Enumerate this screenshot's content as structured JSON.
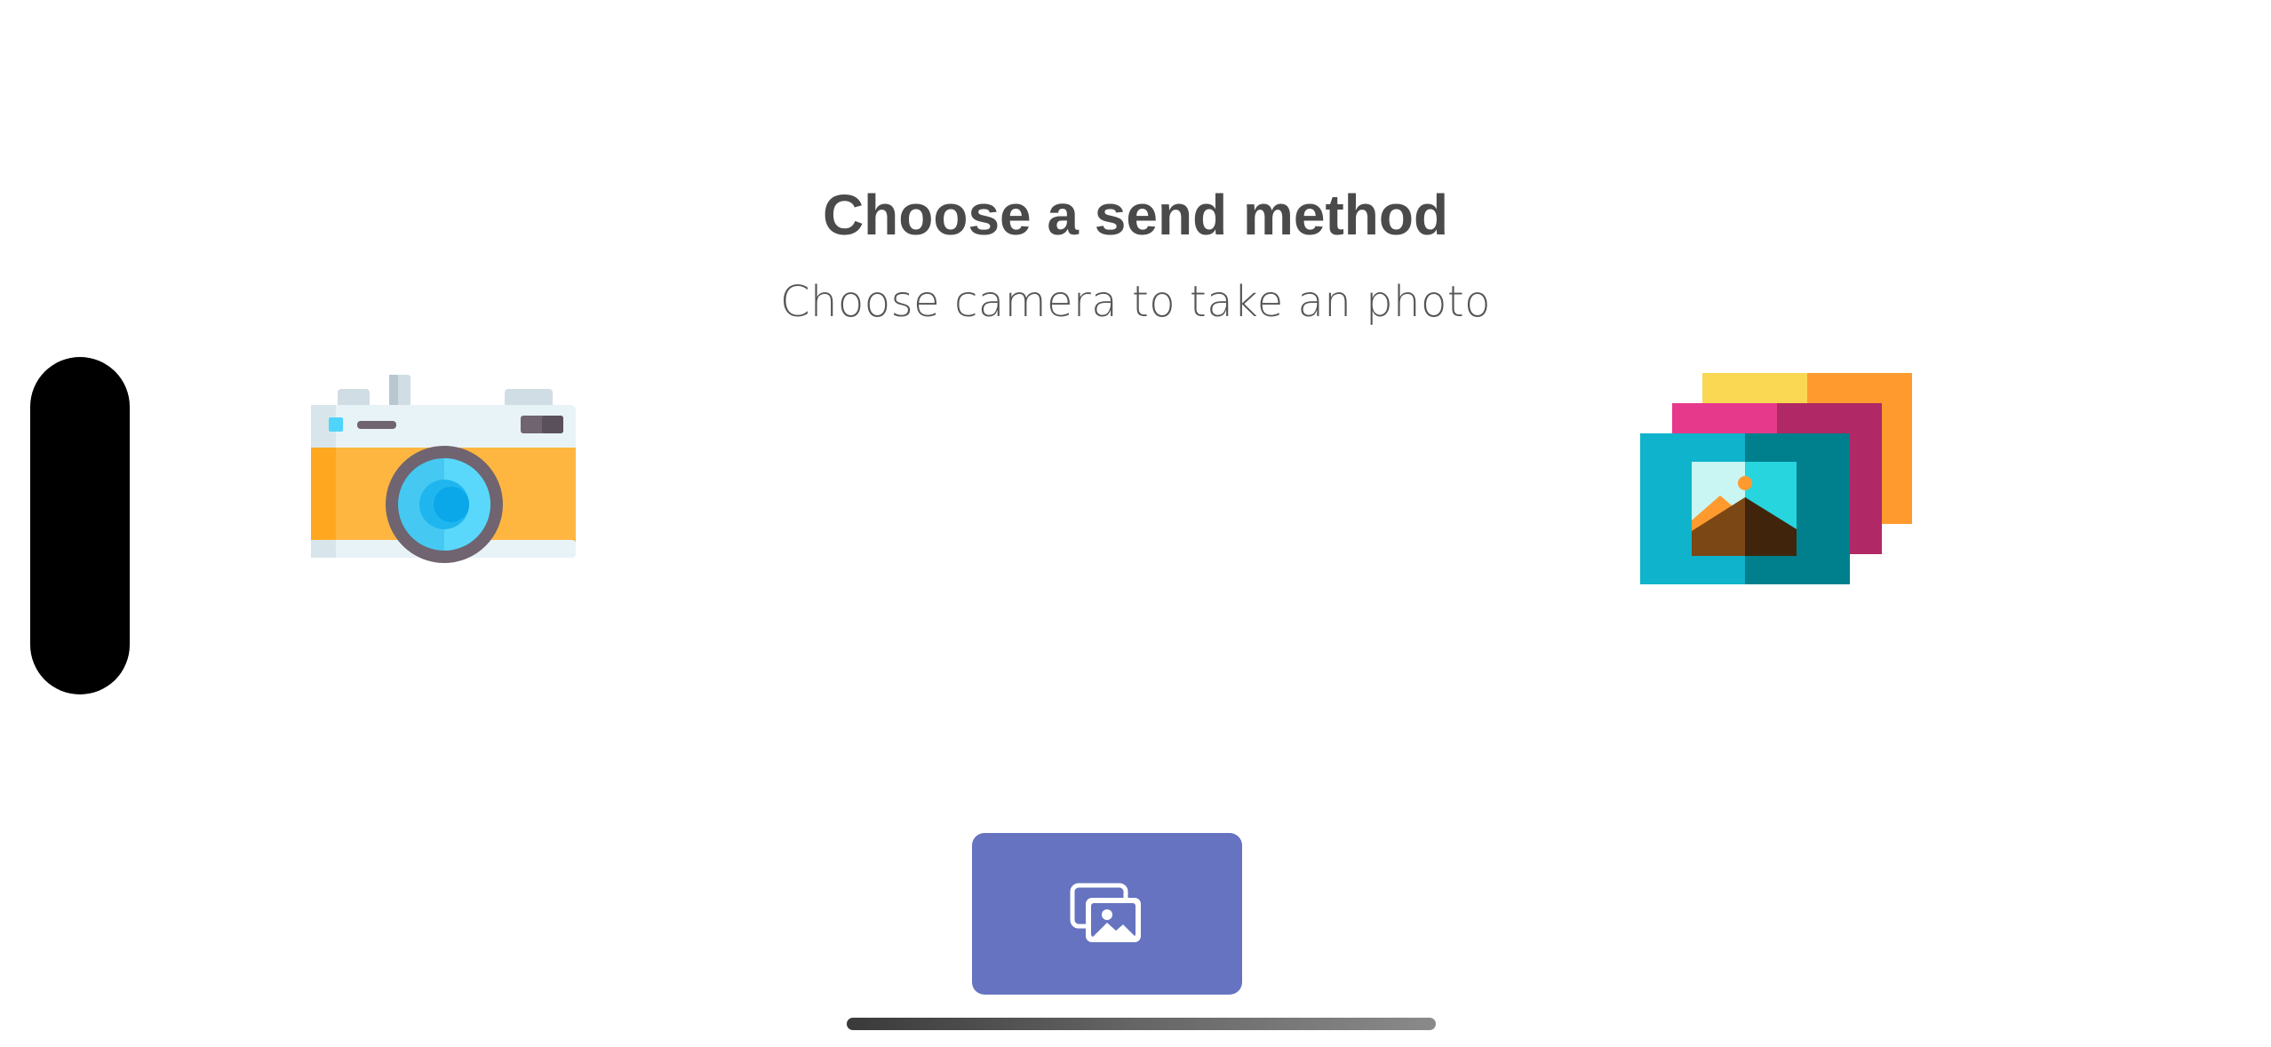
{
  "header": {
    "title": "Choose a send method",
    "subtitle": "Choose camera to take an photo"
  },
  "options": {
    "camera": {
      "icon": "camera-icon"
    },
    "gallery": {
      "icon": "photo-stack-icon"
    }
  },
  "send_button": {
    "icon": "images-icon",
    "color": "#6573c0"
  },
  "colors": {
    "title": "#4a4a4a",
    "subtitle": "#555555",
    "background": "#ffffff"
  }
}
